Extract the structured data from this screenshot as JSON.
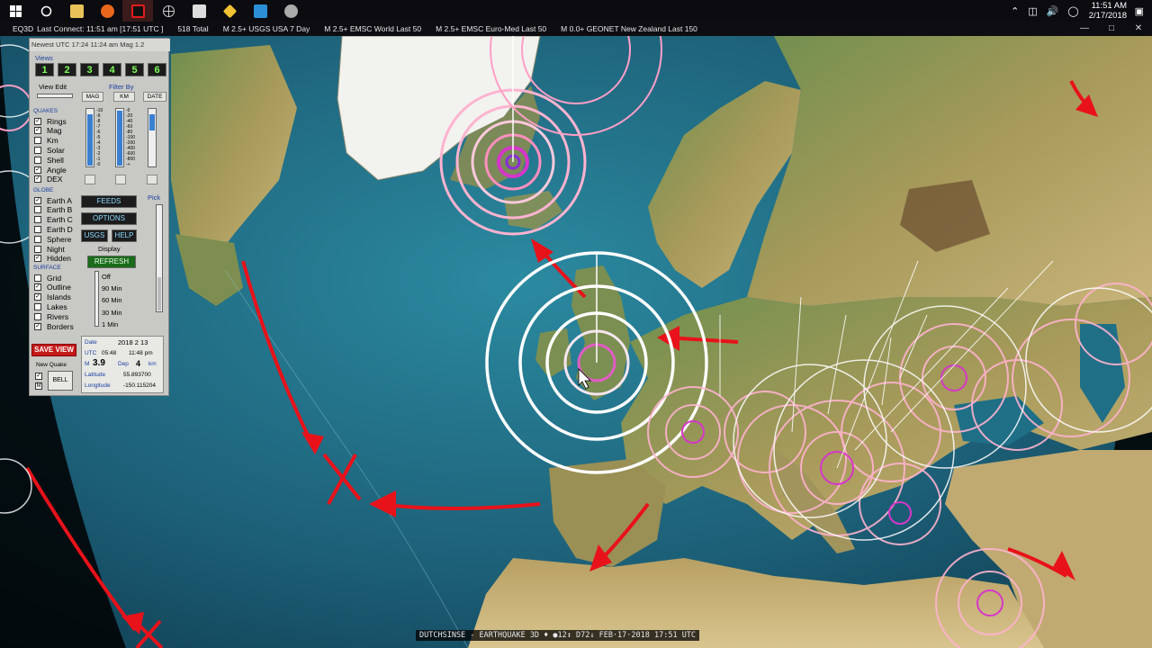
{
  "taskbar": {
    "icons": [
      "windows-start-icon",
      "search-icon",
      "file-explorer-icon",
      "firefox-icon",
      "eq3d-app-icon",
      "globe-app-icon",
      "photos-icon",
      "tools-icon",
      "app-icon",
      "media-icon"
    ],
    "time": "11:51 AM",
    "date": "2/17/2018"
  },
  "titlebar": {
    "app": "EQ3D",
    "last_connect": "Last Connect: 11:51 am  [17:51 UTC ]",
    "total": "518  Total",
    "feeds": [
      "M 2.5+  USGS USA 7 Day",
      "M 2.5+  EMSC World Last 50",
      "M 2.5+  EMSC Euro-Med Last 50",
      "M 0.0+  GEONET New Zealand Last 150"
    ]
  },
  "panel": {
    "newest": "Newest UTC 17:24  11:24 am  Mag 1.2",
    "views_label": "Views",
    "views": [
      "1",
      "2",
      "3",
      "4",
      "5",
      "6"
    ],
    "view_edit_label": "View Edit",
    "filter_label": "Filter By",
    "filter_buttons": [
      "MAG",
      "KM",
      "DATE"
    ],
    "mag_scale": [
      "-10",
      "-9",
      "-8",
      "-7",
      "-6",
      "-5",
      "-4",
      "-3",
      "-2",
      "-1",
      "-0"
    ],
    "km_scale": [
      "-0",
      "-20",
      "-40",
      "-60",
      "-80",
      "-100",
      "-200",
      "-400",
      "-600",
      "-800",
      "-+"
    ],
    "quakes_label": "QUAKES",
    "quakes": [
      {
        "label": "Rings",
        "checked": true
      },
      {
        "label": "Mag",
        "checked": true
      },
      {
        "label": "Km",
        "checked": false
      },
      {
        "label": "Solar",
        "checked": false
      },
      {
        "label": "Shell",
        "checked": false
      },
      {
        "label": "Angle",
        "checked": true
      },
      {
        "label": "DEX",
        "checked": true
      }
    ],
    "globe_label": "GLOBE",
    "globe": [
      {
        "label": "Earth A",
        "checked": true
      },
      {
        "label": "Earth B",
        "checked": false
      },
      {
        "label": "Earth C",
        "checked": false
      },
      {
        "label": "Earth D",
        "checked": false
      },
      {
        "label": "Sphere",
        "checked": false
      },
      {
        "label": "Night",
        "checked": false
      },
      {
        "label": "Hidden",
        "checked": true
      }
    ],
    "surface_label": "SURFACE",
    "surface": [
      {
        "label": "Grid",
        "checked": false
      },
      {
        "label": "Outline",
        "checked": true
      },
      {
        "label": "Islands",
        "checked": true
      },
      {
        "label": "Lakes",
        "checked": false
      },
      {
        "label": "Rivers",
        "checked": false
      },
      {
        "label": "Borders",
        "checked": true
      }
    ],
    "buttons": {
      "feeds": "FEEDS",
      "options": "OPTIONS",
      "usgs": "USGS",
      "help": "HELP",
      "refresh": "REFRESH",
      "save_view": "SAVE VIEW",
      "bell": "BELL"
    },
    "pick_label": "Pick",
    "display_label": "Display",
    "display_options": [
      "Off",
      "90 Min",
      "60 Min",
      "30 Min",
      "1 Min"
    ],
    "new_quake_label": "New Quake",
    "info": {
      "date_label": "Date",
      "date": "2018  2  13",
      "utc_label": "UTC",
      "utc": "05:48",
      "local": "11:48 pm",
      "mag_prefix": "M",
      "mag": "3.9",
      "dep_label": "Dep",
      "dep": "4",
      "km": "km",
      "lat_label": "Latitude",
      "lat": "55.893700",
      "lon_label": "Longitude",
      "lon": "-150.115204"
    }
  },
  "caption": "DUTCHSINSE - EARTHQUAKE 3D  ♦  ●12↕ D72↓ FEB·17·2018 17:51 UTC",
  "colors": {
    "ocean": "#1f6f87",
    "land": "#8a8a4a",
    "ring_white": "#ffffff",
    "ring_pink": "#ff9ec6",
    "arrow_red": "#e8121a"
  }
}
